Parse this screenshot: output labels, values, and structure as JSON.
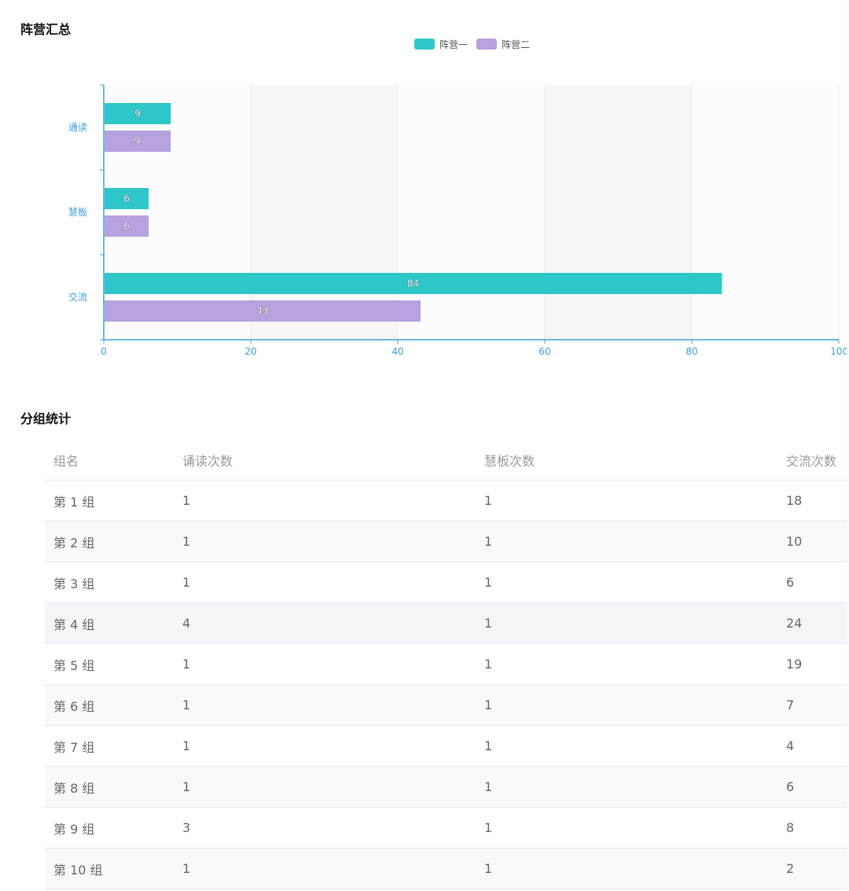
{
  "chart_section": {
    "title": "阵营汇总"
  },
  "chart_data": {
    "type": "bar",
    "orientation": "horizontal",
    "categories": [
      "通读",
      "慧板",
      "交流"
    ],
    "series": [
      {
        "name": "阵营一",
        "color": "#2ec7c9",
        "values": [
          9,
          6,
          84
        ]
      },
      {
        "name": "阵营二",
        "color": "#b6a2de",
        "values": [
          9,
          6,
          43
        ]
      }
    ],
    "xlim": [
      0,
      100
    ],
    "x_ticks": [
      0,
      20,
      40,
      60,
      80,
      100
    ],
    "legend_position": "top-center",
    "axis_color": "#3aa0d8",
    "data_labels": true
  },
  "table_section": {
    "title": "分组统计",
    "columns": [
      "组名",
      "诵读次数",
      "慧板次数",
      "交流次数"
    ],
    "rows": [
      [
        "第 1 组",
        "1",
        "1",
        "18"
      ],
      [
        "第 2 组",
        "1",
        "1",
        "10"
      ],
      [
        "第 3 组",
        "1",
        "1",
        "6"
      ],
      [
        "第 4 组",
        "4",
        "1",
        "24"
      ],
      [
        "第 5 组",
        "1",
        "1",
        "19"
      ],
      [
        "第 6 组",
        "1",
        "1",
        "7"
      ],
      [
        "第 7 组",
        "1",
        "1",
        "4"
      ],
      [
        "第 8 组",
        "1",
        "1",
        "6"
      ],
      [
        "第 9 组",
        "3",
        "1",
        "8"
      ],
      [
        "第 10 组",
        "1",
        "1",
        "2"
      ]
    ]
  }
}
